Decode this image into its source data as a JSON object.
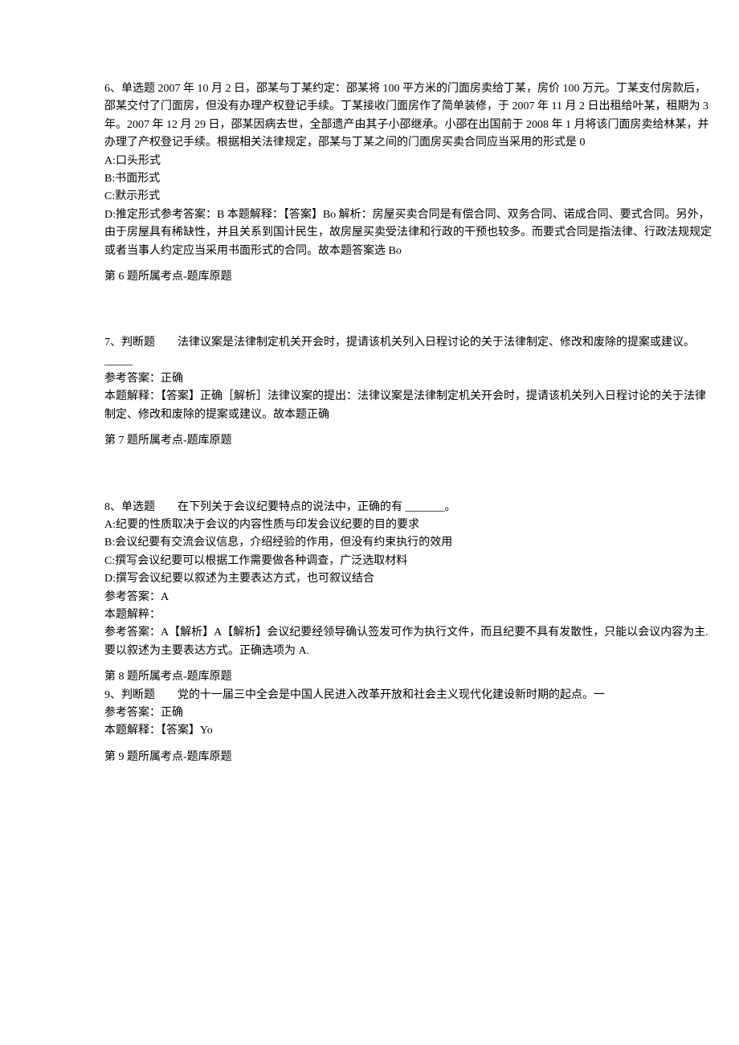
{
  "q6": {
    "stem": "6、单选题 2007 年 10 月 2 日，邵某与丁某约定：邵某将 100 平方米的门面房卖给丁某，房价 100 万元。丁某支付房款后，邵某交付了门面房，但没有办理产权登记手续。丁某接收门面房作了简单装修，于 2007 年 11 月 2 日出租给叶某，租期为 3 年。2007 年 12 月 29 日，邵某因病去世，全部遗产由其子小邵继承。小邵在出国前于 2008 年 1 月将该门面房卖给林某，并办理了产权登记手续。根据相关法律规定，邵某与丁某之间的门面房买卖合同应当采用的形式是 0",
    "optA": "A:口头形式",
    "optB": "B:书面形式",
    "optC": "C:默示形式",
    "optD_and_answer": "D:推定形式参考答案：B 本题解释：【答案】Bo 解析：房屋买卖合同是有偿合同、双务合同、诺成合同、要式合同。另外，由于房屋具有稀缺性，并且关系到国计民生，故房屋买卖受法律和行政的干预也较多。而要式合同是指法律、行政法规规定或者当事人约定应当采用书面形式的合同。故本题答案选 Bo",
    "footer": "第 6 题所属考点-题库原题"
  },
  "q7": {
    "stem": "7、判断题　　法律议案是法律制定机关开会时，提请该机关列入日程讨论的关于法律制定、修改和废除的提案或建议。_____",
    "ans": "参考答案：正确",
    "explain": "本题解释：【答案】正确［解析］法律议案的提出：法律议案是法律制定机关开会时，提请该机关列入日程讨论的关于法律制定、修改和废除的提案或建议。故本题正确",
    "footer": "第 7 题所属考点-题库原题"
  },
  "q8": {
    "stem": "8、单选题　　在下列关于会议纪要特点的说法中，正确的有 _______。",
    "optA": "A:纪要的性质取决于会议的内容性质与印发会议纪要的目的要求",
    "optB": "B:会议纪要有交流会议信息，介绍经验的作用，但没有约束执行的效用",
    "optC": "C:撰写会议纪要可以根据工作需要做各种调查，广泛选取材料",
    "optD": "D:撰写会议纪要以叙述为主要表达方式，也可叙议结合",
    "ans": "参考答案：A",
    "explain_label": "本题解粹：",
    "explain": "参考答案：A【解析】A【解析】会议纪要经领导确认签发可作为执行文件，而且纪要不具有发散性，只能以会议内容为主. 要以叙述为主要表达方式。正确选项为 A.",
    "footer": "第 8 题所属考点-题库原题"
  },
  "q9": {
    "stem": "9、判断题　　党的十一届三中全会是中国人民进入改革开放和社会主义现代化建设新时期的起点。一",
    "ans": "参考答案：正确",
    "explain": "本题解释：【答案】Yo",
    "footer": "第 9 题所属考点-题库原题"
  }
}
